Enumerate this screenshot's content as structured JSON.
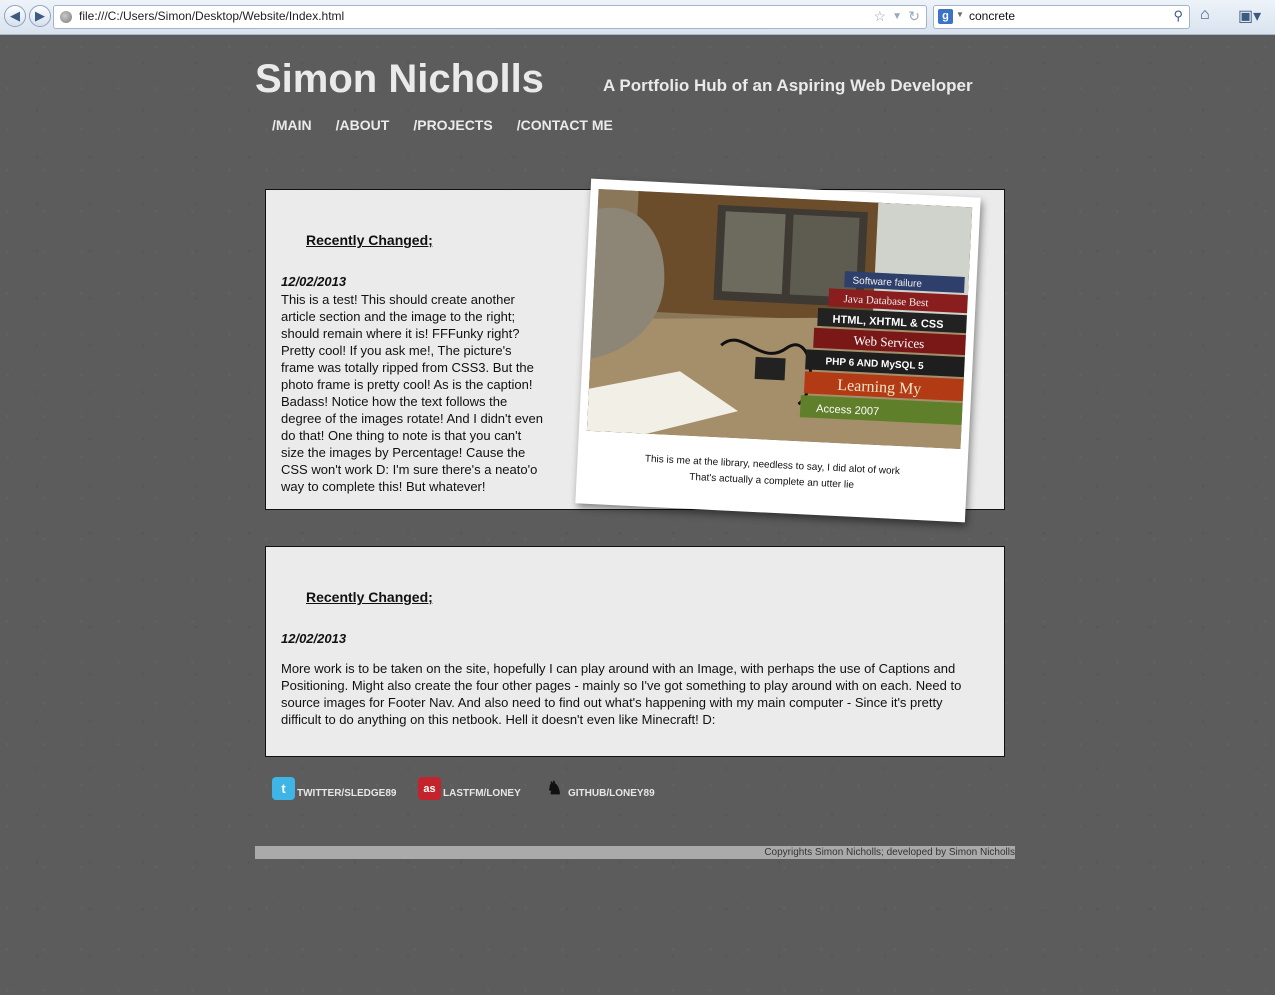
{
  "browser": {
    "url": "file:///C:/Users/Simon/Desktop/Website/Index.html",
    "search_query": "concrete"
  },
  "site": {
    "title": "Simon Nicholls",
    "subtitle": "A Portfolio Hub of an Aspiring Web Developer",
    "nav": [
      "/MAIN",
      "/ABOUT",
      "/PROJECTS",
      "/CONTACT ME"
    ]
  },
  "article1": {
    "heading": "Recently Changed;",
    "date": "12/02/2013",
    "body": "This is a test! This should create another article section and the image to the right; should remain where it is! FFFunky right? Pretty cool! If you ask me!, The picture's frame was totally ripped from CSS3. But the photo frame is pretty cool! As is the caption! Badass! Notice how the text follows the degree of the images rotate! And I didn't even do that! One thing to note is that you can't size the images by Percentage! Cause the CSS won't work D: I'm sure there's a neato'o way to complete this! But whatever!",
    "caption_line1": "This is me at the library, needless to say, I did alot of work",
    "caption_line2": "That's actually a complete an utter lie",
    "book_spines": [
      "Software failure",
      "Java Database Best",
      "HTML, XHTML & CSS",
      "Web Services",
      "PHP 6 AND MySQL 5",
      "Learning My",
      "Access 2007"
    ]
  },
  "article2": {
    "heading": "Recently Changed;",
    "date": "12/02/2013",
    "body": "More work is to be taken on the site, hopefully I can play around with an Image, with perhaps the use of Captions and Positioning. Might also create the four other pages - mainly so I've got something to play around with on each. Need to source images for Footer Nav. And also need to find out what's happening with my main computer - Since it's pretty difficult to do anything on this netbook. Hell it doesn't even like Minecraft! D:"
  },
  "social": {
    "twitter": "TWITTER/SLEDGE89",
    "lastfm": "LASTFM/LONEY",
    "github": "GITHUB/LONEY89"
  },
  "footer": "Copyrights Simon Nicholls; developed by Simon Nicholls",
  "colors": {
    "page_bg": "#5c5c5c",
    "panel_bg": "#ebebeb",
    "twitter": "#3fb5e6",
    "lastfm": "#c3232d"
  }
}
